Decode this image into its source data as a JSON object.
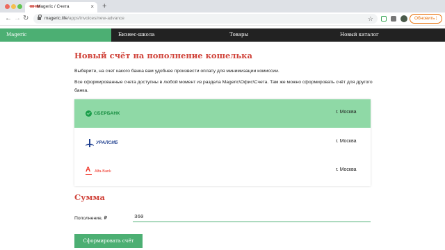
{
  "browser": {
    "tab_title": "Mageric / Счета",
    "tab_favicon": "ᚓᚓ",
    "tab_close": "×",
    "new_tab": "+",
    "back_icon": "←",
    "forward_icon": "→",
    "reload_icon": "↻",
    "url_host": "mageric.life",
    "url_path": "/apps/invoices/new-advance",
    "star_icon": "☆",
    "update_label": "Обновить",
    "menu_icon": "⋮",
    "accent_color": "#e8710a"
  },
  "nav": {
    "items": [
      {
        "label": "Mageric",
        "active": true
      },
      {
        "label": "Бизнес-школа",
        "active": false
      },
      {
        "label": "Товары",
        "active": false
      },
      {
        "label": "Новый каталог",
        "active": false
      }
    ],
    "active_color": "#4caf73"
  },
  "page": {
    "title": "Новый счёт на пополнение кошелька",
    "paragraph1": "Выберите, на счет какого банка вам удобнее произвести оплату для минимизации комиссии.",
    "paragraph2": "Все сформированные счета доступны в любой момент из раздела Mageric\\Офис\\Счета. Там же можно сформировать счёт для другого банка."
  },
  "banks": [
    {
      "name": "СБЕРБАНК",
      "city": "г. Москва",
      "selected": true,
      "logo": "sberbank-logo"
    },
    {
      "name": "УРАЛСИБ",
      "city": "г. Москва",
      "selected": false,
      "logo": "uralsib-logo"
    },
    {
      "name": "Alfa-Bank",
      "city": "г. Москва",
      "selected": false,
      "logo": "alfabank-logo"
    }
  ],
  "amount": {
    "section_title": "Сумма",
    "label": "Пополнение, ₽",
    "value": "360",
    "submit_label": "Сформировать счёт"
  }
}
